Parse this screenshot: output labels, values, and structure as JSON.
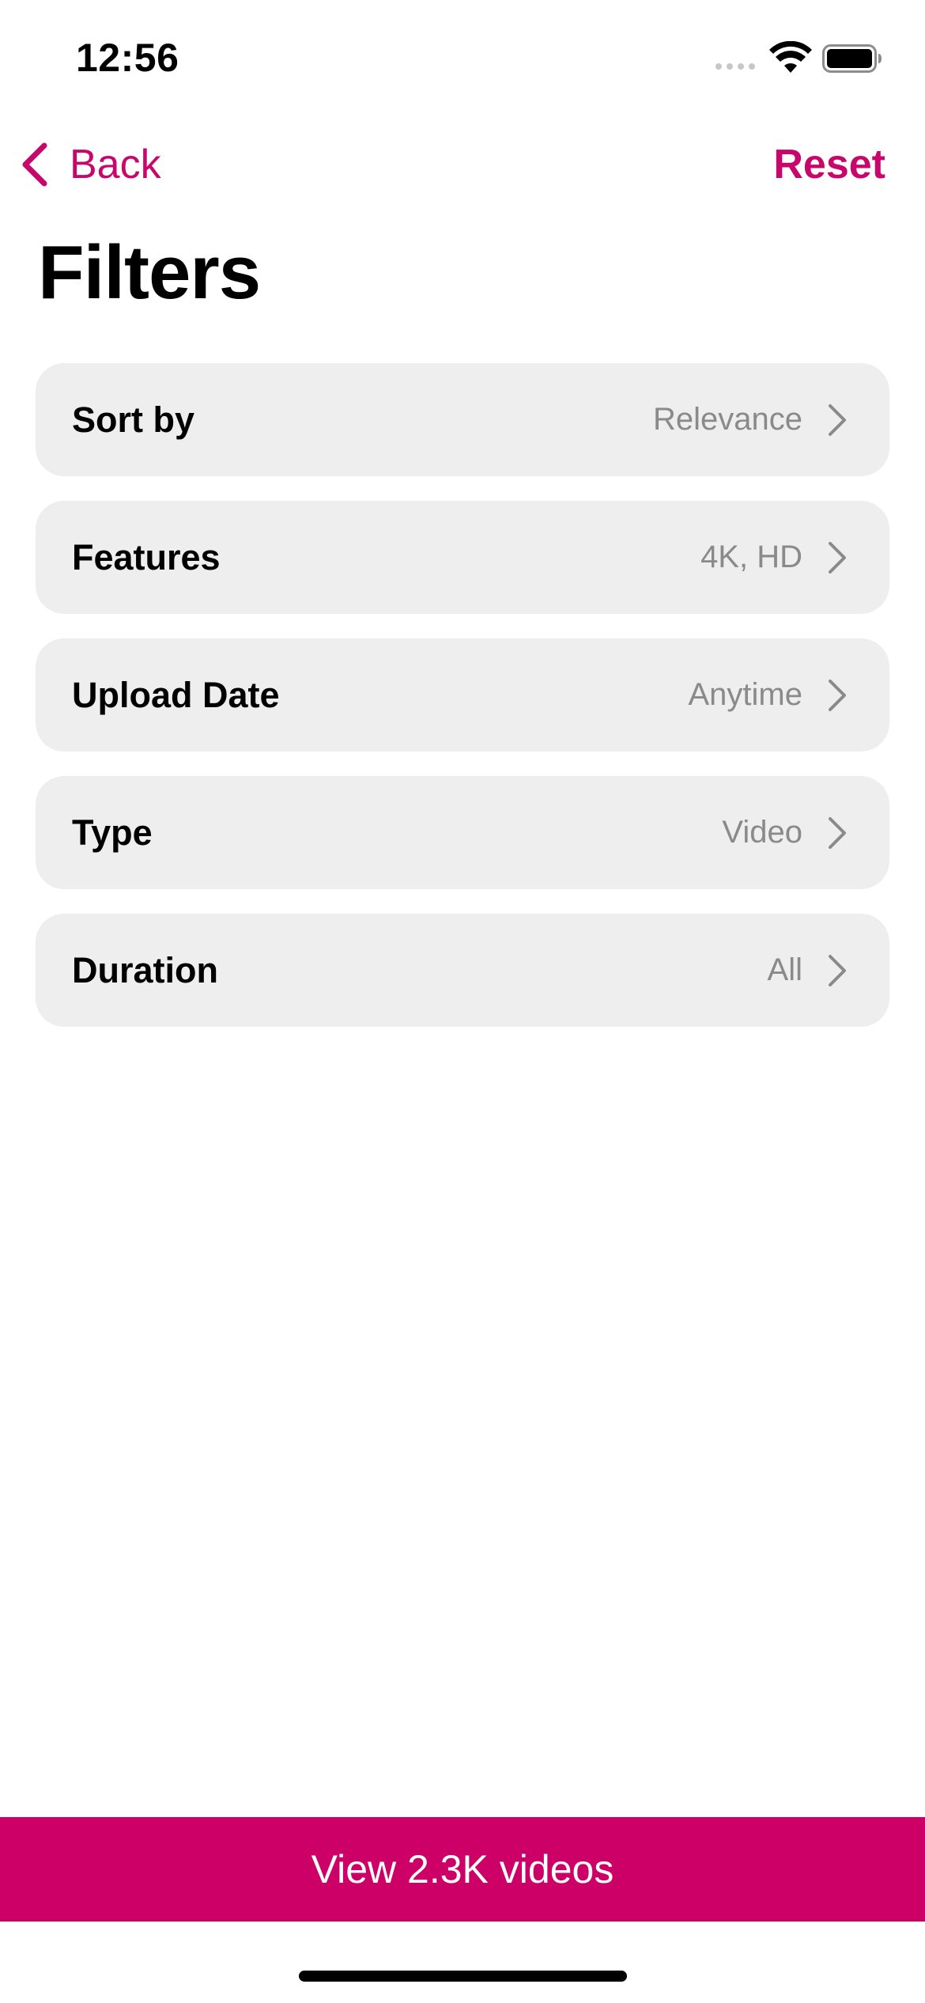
{
  "status_bar": {
    "time": "12:56"
  },
  "nav": {
    "back_label": "Back",
    "reset_label": "Reset"
  },
  "page": {
    "title": "Filters"
  },
  "filters": [
    {
      "label": "Sort by",
      "value": "Relevance"
    },
    {
      "label": "Features",
      "value": "4K, HD"
    },
    {
      "label": "Upload Date",
      "value": "Anytime"
    },
    {
      "label": "Type",
      "value": "Video"
    },
    {
      "label": "Duration",
      "value": "All"
    }
  ],
  "action": {
    "view_label": "View 2.3K videos"
  },
  "colors": {
    "accent": "#cc0066",
    "accent_text": "#c8076d",
    "row_background": "#eeeeee",
    "secondary_text": "#8a8a8a"
  },
  "icons": {
    "back": "chevron-left-icon",
    "row": "chevron-right-icon",
    "wifi": "wifi-icon",
    "battery": "battery-icon",
    "signal": "signal-icon"
  }
}
